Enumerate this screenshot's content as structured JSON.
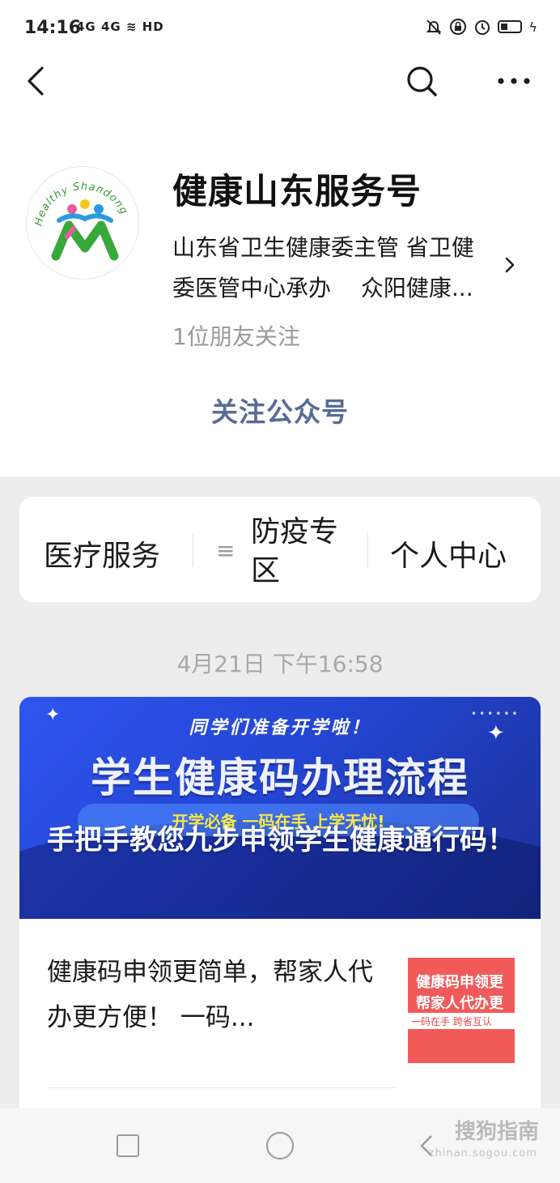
{
  "status_bar": {
    "time": "14:16",
    "left_icons": "4G 4G ≋ HD",
    "icons": [
      "bell-off-icon",
      "lock-rotation-icon",
      "alarm-icon",
      "battery-icon",
      "charging-icon"
    ]
  },
  "nav": {
    "back_icon": "back-arrow-icon",
    "search_icon": "search-icon",
    "more_icon": "more-icon"
  },
  "profile": {
    "logo_text": "Healthy Shandong",
    "name": "健康山东服务号",
    "description_line1": "山东省卫生健康委主管 省卫健",
    "description_line2": "委医管中心承办　 众阳健康...",
    "followers": "1位朋友关注",
    "follow_label": "关注公众号"
  },
  "menu": {
    "items": [
      {
        "label": "医疗服务"
      },
      {
        "label_line1": "防疫专",
        "label_line2": "区"
      },
      {
        "label": "个人中心"
      }
    ]
  },
  "timestamp": "4月21日 下午16:58",
  "article": {
    "banner_subtitle": "同学们准备开学啦！",
    "banner_heading": "学生健康码办理流程",
    "banner_tagline": "开学必备 一码在手 上学无忧!",
    "title": "手把手教您九步申领学生健康通行码！",
    "sub_title": "健康码申领更简单，帮家人代办更方便！ 一码...",
    "thumb_line1": "健康码申领更",
    "thumb_line2": "帮家人代办更",
    "thumb_small": "一码在手 跨省互认"
  },
  "watermark": {
    "brand": "搜狗指南",
    "url": "zhinan.sogou.com"
  },
  "colors": {
    "link_blue": "#576b95",
    "background": "#ededed",
    "banner_blue": "#2f55f0",
    "thumb_red": "#f25a5a"
  }
}
